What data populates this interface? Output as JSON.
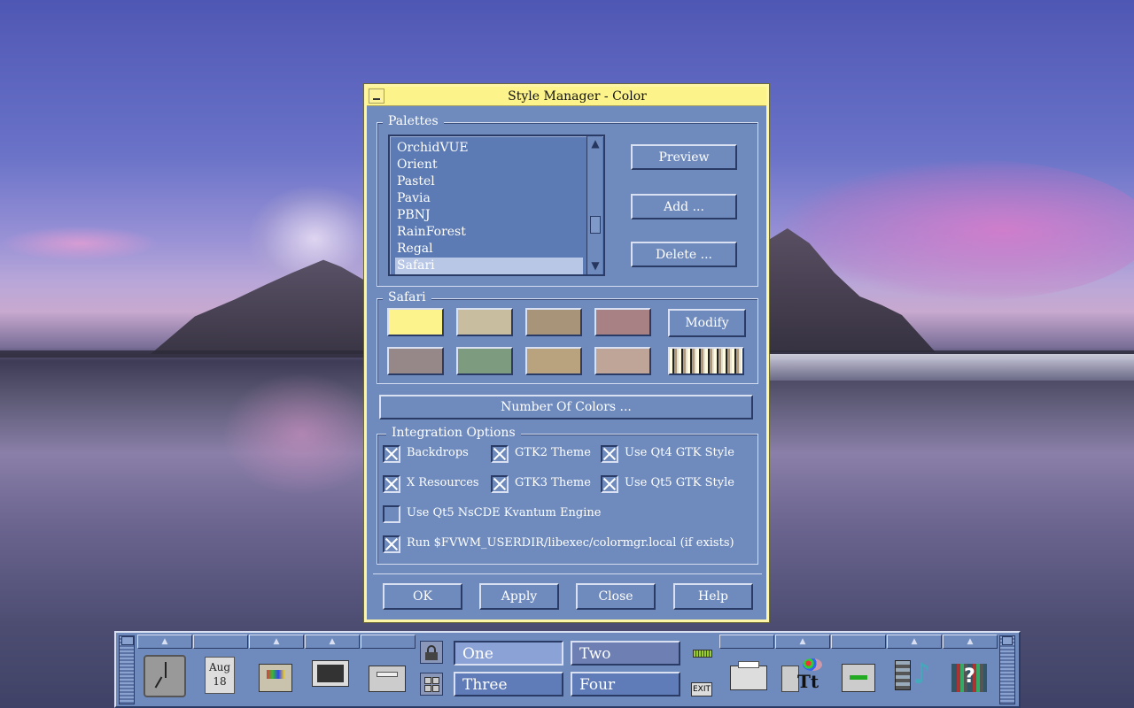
{
  "window": {
    "title": "Style Manager - Color"
  },
  "palettes": {
    "label": "Palettes",
    "items": [
      "OrchidVUE",
      "Orient",
      "Pastel",
      "Pavia",
      "PBNJ",
      "RainForest",
      "Regal",
      "Safari"
    ],
    "selected": "Safari",
    "preview_label": "Preview",
    "add_label": "Add ...",
    "delete_label": "Delete ..."
  },
  "current_palette": {
    "label": "Safari",
    "swatches_row1": [
      "#fdf38c",
      "#c8bd9f",
      "#a89579",
      "#a78183"
    ],
    "swatches_row2": [
      "#968789",
      "#7d9b7f",
      "#b9a37e",
      "#bfa598"
    ],
    "modify_label": "Modify"
  },
  "number_of_colors_label": "Number Of Colors ...",
  "integration": {
    "label": "Integration Options",
    "options": [
      {
        "label": "Backdrops",
        "checked": true
      },
      {
        "label": "GTK2 Theme",
        "checked": true
      },
      {
        "label": "Use Qt4 GTK Style",
        "checked": true
      },
      {
        "label": "X Resources",
        "checked": true
      },
      {
        "label": "GTK3 Theme",
        "checked": true
      },
      {
        "label": "Use Qt5 GTK Style",
        "checked": true
      },
      {
        "label": "Use Qt5 NsCDE Kvantum Engine",
        "checked": false
      },
      {
        "label": "Run $FVWM_USERDIR/libexec/colormgr.local (if exists)",
        "checked": true
      }
    ]
  },
  "buttons": {
    "ok": "OK",
    "apply": "Apply",
    "close": "Close",
    "help": "Help"
  },
  "panel": {
    "calendar": {
      "month": "Aug",
      "day": "18"
    },
    "workspaces": [
      "One",
      "Two",
      "Three",
      "Four"
    ],
    "active_workspace": "One",
    "exit_label": "EXIT"
  },
  "icons": {
    "clock": "clock-icon",
    "calendar": "calendar-icon",
    "file-manager": "file-manager-icon",
    "terminal": "terminal-icon",
    "mail": "mail-icon",
    "lock": "lock-icon",
    "windows": "window-list-icon",
    "printer": "printer-icon",
    "fonts": "style-manager-icon",
    "editor": "editor-icon",
    "media": "media-icon",
    "help": "help-icon"
  }
}
